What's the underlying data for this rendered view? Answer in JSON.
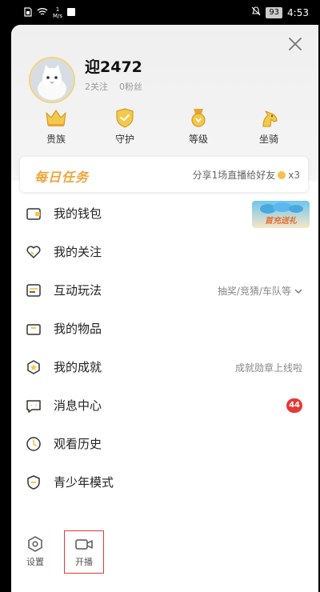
{
  "status_bar": {
    "speed_value": "1",
    "speed_unit": "M/s",
    "battery": "93",
    "time": "4:53"
  },
  "profile": {
    "username": "迎2472",
    "following": "2关注",
    "fans": "0粉丝"
  },
  "badges": [
    {
      "label": "贵族",
      "icon": "crown-icon"
    },
    {
      "label": "守护",
      "icon": "shield-icon"
    },
    {
      "label": "等级",
      "icon": "level-icon"
    },
    {
      "label": "坐骑",
      "icon": "horse-icon"
    }
  ],
  "daily_task": {
    "title": "每日任务",
    "description": "分享1场直播给好友",
    "reward": "x3"
  },
  "menu": [
    {
      "label": "我的钱包",
      "icon": "wallet-icon",
      "promo": "首充送礼"
    },
    {
      "label": "我的关注",
      "icon": "heart-icon"
    },
    {
      "label": "互动玩法",
      "icon": "interact-icon",
      "extra": "抽奖/竞猜/车队等"
    },
    {
      "label": "我的物品",
      "icon": "box-icon"
    },
    {
      "label": "我的成就",
      "icon": "achievement-icon",
      "extra": "成就勋章上线啦"
    },
    {
      "label": "消息中心",
      "icon": "message-icon",
      "badge": "44"
    },
    {
      "label": "观看历史",
      "icon": "clock-icon"
    },
    {
      "label": "青少年模式",
      "icon": "youth-shield-icon"
    }
  ],
  "bottom": {
    "settings_label": "设置",
    "broadcast_label": "开播"
  },
  "colors": {
    "accent": "#f0a63c",
    "badge_red": "#e53935",
    "icon_gold": "#e8a432"
  }
}
